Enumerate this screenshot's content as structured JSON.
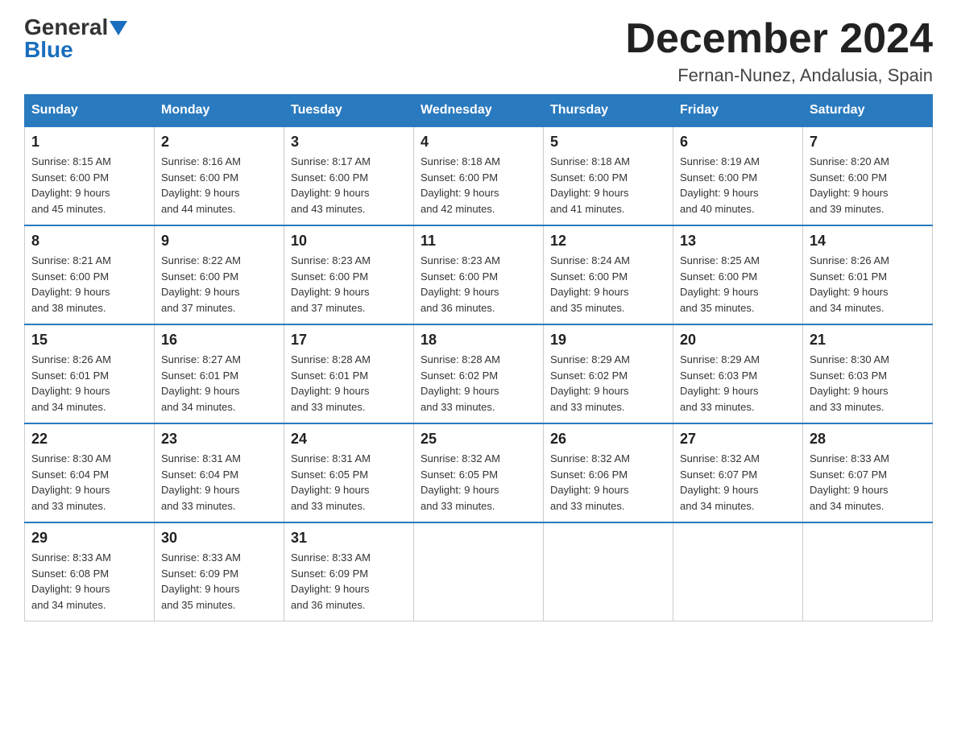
{
  "header": {
    "logo_line1": "General",
    "logo_line2": "Blue",
    "month_title": "December 2024",
    "location": "Fernan-Nunez, Andalusia, Spain"
  },
  "days_of_week": [
    "Sunday",
    "Monday",
    "Tuesday",
    "Wednesday",
    "Thursday",
    "Friday",
    "Saturday"
  ],
  "weeks": [
    [
      {
        "day": "1",
        "sunrise": "8:15 AM",
        "sunset": "6:00 PM",
        "daylight": "9 hours and 45 minutes."
      },
      {
        "day": "2",
        "sunrise": "8:16 AM",
        "sunset": "6:00 PM",
        "daylight": "9 hours and 44 minutes."
      },
      {
        "day": "3",
        "sunrise": "8:17 AM",
        "sunset": "6:00 PM",
        "daylight": "9 hours and 43 minutes."
      },
      {
        "day": "4",
        "sunrise": "8:18 AM",
        "sunset": "6:00 PM",
        "daylight": "9 hours and 42 minutes."
      },
      {
        "day": "5",
        "sunrise": "8:18 AM",
        "sunset": "6:00 PM",
        "daylight": "9 hours and 41 minutes."
      },
      {
        "day": "6",
        "sunrise": "8:19 AM",
        "sunset": "6:00 PM",
        "daylight": "9 hours and 40 minutes."
      },
      {
        "day": "7",
        "sunrise": "8:20 AM",
        "sunset": "6:00 PM",
        "daylight": "9 hours and 39 minutes."
      }
    ],
    [
      {
        "day": "8",
        "sunrise": "8:21 AM",
        "sunset": "6:00 PM",
        "daylight": "9 hours and 38 minutes."
      },
      {
        "day": "9",
        "sunrise": "8:22 AM",
        "sunset": "6:00 PM",
        "daylight": "9 hours and 37 minutes."
      },
      {
        "day": "10",
        "sunrise": "8:23 AM",
        "sunset": "6:00 PM",
        "daylight": "9 hours and 37 minutes."
      },
      {
        "day": "11",
        "sunrise": "8:23 AM",
        "sunset": "6:00 PM",
        "daylight": "9 hours and 36 minutes."
      },
      {
        "day": "12",
        "sunrise": "8:24 AM",
        "sunset": "6:00 PM",
        "daylight": "9 hours and 35 minutes."
      },
      {
        "day": "13",
        "sunrise": "8:25 AM",
        "sunset": "6:00 PM",
        "daylight": "9 hours and 35 minutes."
      },
      {
        "day": "14",
        "sunrise": "8:26 AM",
        "sunset": "6:01 PM",
        "daylight": "9 hours and 34 minutes."
      }
    ],
    [
      {
        "day": "15",
        "sunrise": "8:26 AM",
        "sunset": "6:01 PM",
        "daylight": "9 hours and 34 minutes."
      },
      {
        "day": "16",
        "sunrise": "8:27 AM",
        "sunset": "6:01 PM",
        "daylight": "9 hours and 34 minutes."
      },
      {
        "day": "17",
        "sunrise": "8:28 AM",
        "sunset": "6:01 PM",
        "daylight": "9 hours and 33 minutes."
      },
      {
        "day": "18",
        "sunrise": "8:28 AM",
        "sunset": "6:02 PM",
        "daylight": "9 hours and 33 minutes."
      },
      {
        "day": "19",
        "sunrise": "8:29 AM",
        "sunset": "6:02 PM",
        "daylight": "9 hours and 33 minutes."
      },
      {
        "day": "20",
        "sunrise": "8:29 AM",
        "sunset": "6:03 PM",
        "daylight": "9 hours and 33 minutes."
      },
      {
        "day": "21",
        "sunrise": "8:30 AM",
        "sunset": "6:03 PM",
        "daylight": "9 hours and 33 minutes."
      }
    ],
    [
      {
        "day": "22",
        "sunrise": "8:30 AM",
        "sunset": "6:04 PM",
        "daylight": "9 hours and 33 minutes."
      },
      {
        "day": "23",
        "sunrise": "8:31 AM",
        "sunset": "6:04 PM",
        "daylight": "9 hours and 33 minutes."
      },
      {
        "day": "24",
        "sunrise": "8:31 AM",
        "sunset": "6:05 PM",
        "daylight": "9 hours and 33 minutes."
      },
      {
        "day": "25",
        "sunrise": "8:32 AM",
        "sunset": "6:05 PM",
        "daylight": "9 hours and 33 minutes."
      },
      {
        "day": "26",
        "sunrise": "8:32 AM",
        "sunset": "6:06 PM",
        "daylight": "9 hours and 33 minutes."
      },
      {
        "day": "27",
        "sunrise": "8:32 AM",
        "sunset": "6:07 PM",
        "daylight": "9 hours and 34 minutes."
      },
      {
        "day": "28",
        "sunrise": "8:33 AM",
        "sunset": "6:07 PM",
        "daylight": "9 hours and 34 minutes."
      }
    ],
    [
      {
        "day": "29",
        "sunrise": "8:33 AM",
        "sunset": "6:08 PM",
        "daylight": "9 hours and 34 minutes."
      },
      {
        "day": "30",
        "sunrise": "8:33 AM",
        "sunset": "6:09 PM",
        "daylight": "9 hours and 35 minutes."
      },
      {
        "day": "31",
        "sunrise": "8:33 AM",
        "sunset": "6:09 PM",
        "daylight": "9 hours and 36 minutes."
      },
      null,
      null,
      null,
      null
    ]
  ],
  "labels": {
    "sunrise": "Sunrise:",
    "sunset": "Sunset:",
    "daylight": "Daylight:"
  }
}
